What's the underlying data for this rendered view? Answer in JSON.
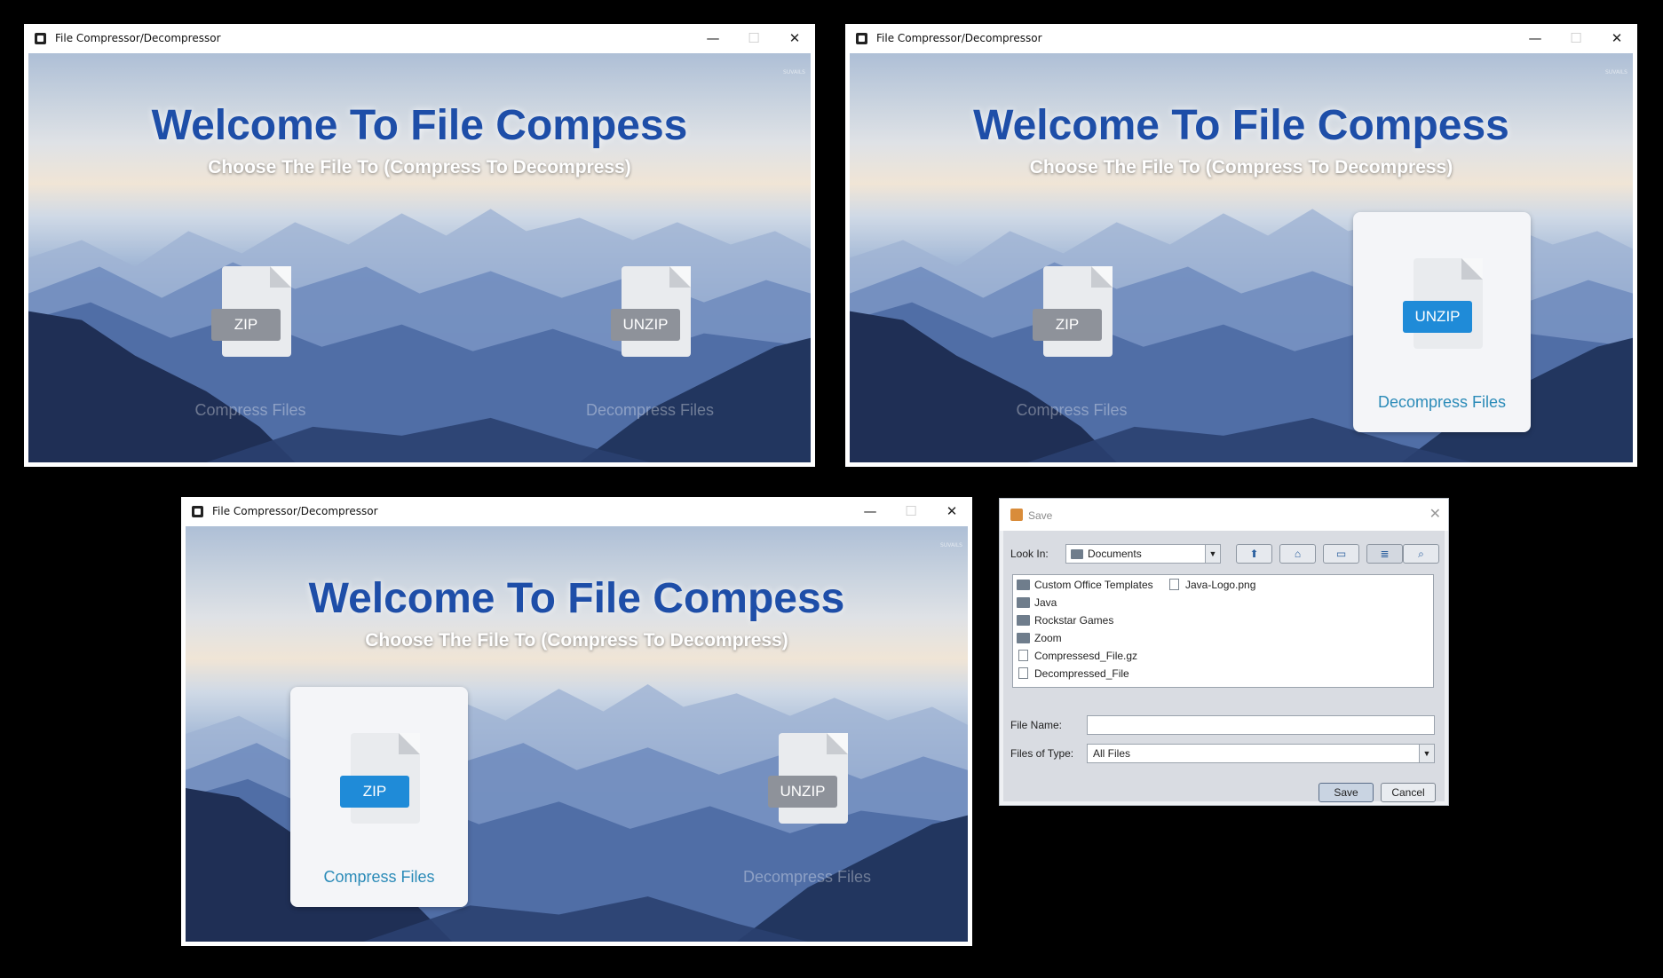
{
  "windows": [
    {
      "title": "File Compressor/Decompressor",
      "heading": "Welcome To File Compess",
      "subheading": "Choose The File To (Compress To Decompress)",
      "watermark": "SUVAILS",
      "zip_label": "ZIP",
      "zip_caption": "Compress Files",
      "unzip_label": "UNZIP",
      "unzip_caption": "Decompress Files",
      "active_card": "none"
    },
    {
      "title": "File Compressor/Decompressor",
      "heading": "Welcome To File Compess",
      "subheading": "Choose The File To (Compress To Decompress)",
      "watermark": "SUVAILS",
      "zip_label": "ZIP",
      "zip_caption": "Compress Files",
      "unzip_label": "UNZIP",
      "unzip_caption": "Decompress Files",
      "active_card": "unzip"
    },
    {
      "title": "File Compressor/Decompressor",
      "heading": "Welcome To File Compess",
      "subheading": "Choose The File To (Compress To Decompress)",
      "watermark": "SUVAILS",
      "zip_label": "ZIP",
      "zip_caption": "Compress Files",
      "unzip_label": "UNZIP",
      "unzip_caption": "Decompress Files",
      "active_card": "zip"
    }
  ],
  "window_controls": {
    "minimize": "—",
    "maximize": "☐",
    "close": "✕"
  },
  "save_dialog": {
    "title": "Save",
    "close": "✕",
    "look_in_label": "Look In:",
    "look_in_value": "Documents",
    "toolbar_icons": [
      "up-folder-icon",
      "home-icon",
      "new-folder-icon",
      "list-view-icon",
      "details-view-icon"
    ],
    "files": [
      {
        "name": "Custom Office Templates",
        "type": "folder"
      },
      {
        "name": "Java",
        "type": "folder"
      },
      {
        "name": "Rockstar Games",
        "type": "folder"
      },
      {
        "name": "Zoom",
        "type": "folder"
      },
      {
        "name": "Compressesd_File.gz",
        "type": "file"
      },
      {
        "name": "Decompressed_File",
        "type": "file"
      },
      {
        "name": "Java-Logo.png",
        "type": "file"
      }
    ],
    "file_name_label": "File Name:",
    "file_name_value": "",
    "files_of_type_label": "Files of Type:",
    "files_of_type_value": "All Files",
    "save_button": "Save",
    "cancel_button": "Cancel"
  }
}
